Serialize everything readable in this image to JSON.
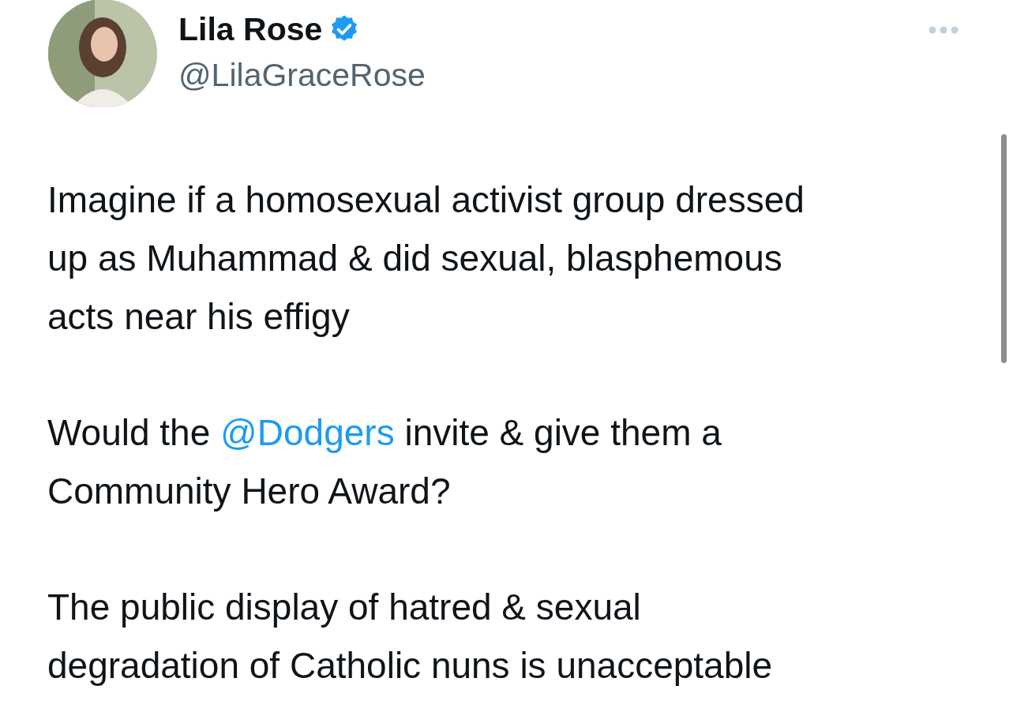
{
  "author": {
    "name": "Lila Rose",
    "verified": true,
    "handle": "@LilaGraceRose"
  },
  "paragraphs": [
    {
      "lines": [
        [
          {
            "kind": "text",
            "text": "Imagine if a homosexual activist group dressed"
          }
        ],
        [
          {
            "kind": "text",
            "text": "up as Muhammad & did sexual, blasphemous"
          }
        ],
        [
          {
            "kind": "text",
            "text": "acts near his effigy"
          }
        ]
      ]
    },
    {
      "lines": [
        [
          {
            "kind": "text",
            "text": "Would the "
          },
          {
            "kind": "mention",
            "text": "@Dodgers"
          },
          {
            "kind": "text",
            "text": " invite & give them a"
          }
        ],
        [
          {
            "kind": "text",
            "text": "Community Hero Award?"
          }
        ]
      ]
    },
    {
      "lines": [
        [
          {
            "kind": "text",
            "text": "The public display of hatred & sexual"
          }
        ],
        [
          {
            "kind": "text",
            "text": "degradation of Catholic nuns is unacceptable"
          }
        ]
      ]
    }
  ]
}
